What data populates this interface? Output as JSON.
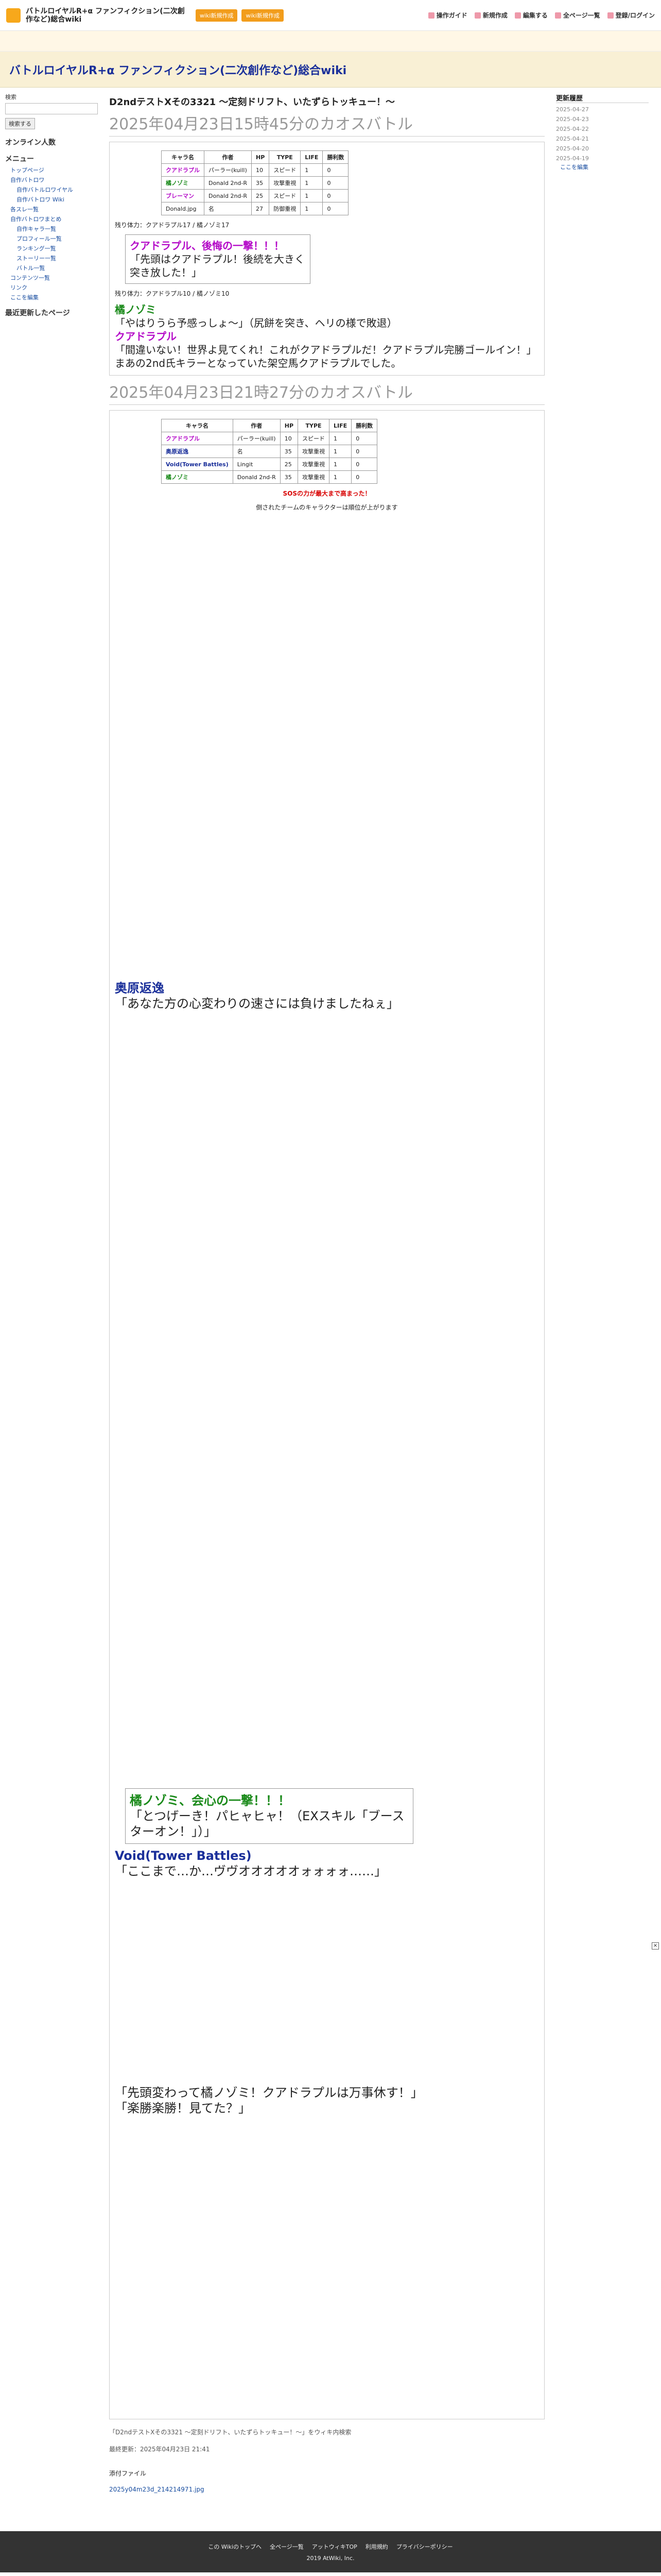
{
  "header": {
    "site_name": "バトルロイヤルR+α ファンフィクション(二次創作など)総合wiki",
    "buttons": [
      "wiki新規作成",
      "wiki新規作成"
    ],
    "nav": [
      "操作ガイド",
      "新規作成",
      "編集する",
      "全ページ一覧",
      "登録/ログイン"
    ]
  },
  "banner": {
    "title": "バトルロイヤルR+α ファンフィクション(二次創作など)総合wiki"
  },
  "left": {
    "search_label": "検索",
    "search_button": "検索する",
    "online_label": "オンライン人数",
    "menu_title": "メニュー",
    "menu_items": [
      "トップページ",
      "自作バトロワ",
      "自作バトルロワイヤル",
      "自作バトロワ Wiki",
      "各スレ一覧",
      "自作バトロワまとめ",
      "自作キャラ一覧",
      "プロフィール一覧",
      "ランキング一覧",
      "ストーリー一覧",
      "バトル一覧",
      "コンテンツ一覧",
      "リンク",
      "ここを編集"
    ],
    "recent_title": "最近更新したページ"
  },
  "main": {
    "page_title": "D2ndテストXその3321 ～定刻ドリフト、いたずらトッキュー！～",
    "section1": "2025年04月23日15時45分のカオスバトル",
    "section2": "2025年04月23日21時27分のカオスバトル",
    "roster_headers": [
      "キャラ名",
      "作者",
      "HP",
      "TYPE",
      "LIFE",
      "勝利数"
    ],
    "roster1": [
      [
        "クアドラプル",
        "パーラー(kuill)",
        "10",
        "スピード",
        "1",
        "0"
      ],
      [
        "橘ノゾミ",
        "Donald 2nd-R",
        "35",
        "攻撃重視",
        "1",
        "0"
      ],
      [
        "ブレーマン",
        "Donald 2nd-R",
        "25",
        "スピード",
        "1",
        "0"
      ],
      [
        "Donald.jpg",
        "名",
        "27",
        "防御重視",
        "1",
        "0"
      ]
    ],
    "roster2": [
      [
        "クアドラプル",
        "パーラー(kuill)",
        "10",
        "スピード",
        "1",
        "0"
      ],
      [
        "奥原返逸",
        "名",
        "35",
        "攻撃重視",
        "1",
        "0"
      ],
      [
        "Void(Tower Battles)",
        "Lingit",
        "25",
        "攻撃重視",
        "1",
        "0"
      ],
      [
        "橘ノゾミ",
        "Donald 2nd-R",
        "35",
        "攻撃重視",
        "1",
        "0"
      ]
    ],
    "lines": {
      "l1": "残り体力：クアドラプル17 / 橘ノゾミ17",
      "l2": "クアドラプル、後悔の一撃！！！",
      "l3": "「先頭はクアドラプル！後続を大きく突き放した！」",
      "l4": "残り体力：クアドラプル10 / 橘ノゾミ10",
      "l5": "橘ノゾミ",
      "l6": "「やはりうら予感っしょ～」（尻餅を突き、ヘリの様で敗退）",
      "l7": "クアドラプル",
      "l8": "「間違いない！世界よ見てくれ！これがクアドラプルだ！クアドラプル完勝ゴールイン！」",
      "l9": "まあの2nd氏キラーとなっていた架空馬クアドラプルでした。",
      "announce1": "SOSの力が最大まで高まった！",
      "announce2": "倒されたチームのキャラクターは順位が上がります",
      "l10": "奥原返逸",
      "l11": "「あなた方の心変わりの速さには負けましたねぇ」",
      "l12": "Void(Tower Battles)",
      "l13": "「ここまで…か…ヴヴオオオオオォォォォ……」",
      "l14": "橘ノゾミ、会心の一撃！！！",
      "l15": "「とつげーき！パヒャヒャ！（EXスキル「ブースターオン！」）」",
      "l16": "「先頭変わって橘ノゾミ！クアドラプルは万事休す！」",
      "l17": "「楽勝楽勝！見てた？」"
    },
    "caption": "「D2ndテストXその3321 ～定刻ドリフト、いたずらトッキュー！～」をウィキ内検索",
    "updated": "最終更新：2025年04月23日 21:41",
    "attach_label": "添付ファイル",
    "attach_file": "2025y04m23d_214214971.jpg"
  },
  "right": {
    "title": "更新履歴",
    "dates": [
      "2025-04-27",
      "2025-04-23",
      "2025-04-22",
      "2025-04-21",
      "2025-04-20",
      "2025-04-19"
    ],
    "edit": "ここを編集"
  },
  "footer": {
    "links": [
      "この Wikiのトップへ",
      "全ページ一覧",
      "アットウィキTOP",
      "利用規約",
      "プライバシーポリシー"
    ],
    "copyright": "2019 AtWiki, Inc."
  }
}
